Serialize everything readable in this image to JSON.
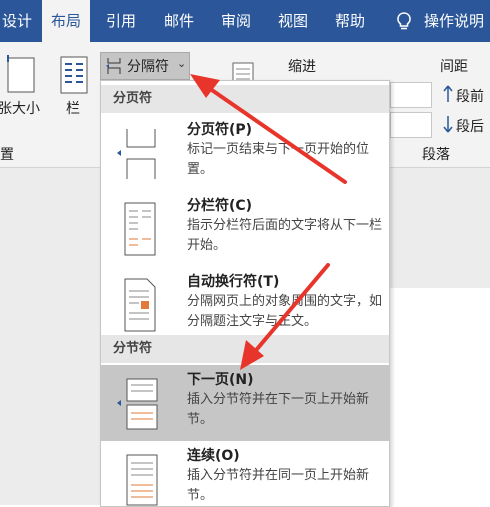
{
  "tabs": [
    {
      "label": "设计",
      "active": false
    },
    {
      "label": "布局",
      "active": true
    },
    {
      "label": "引用",
      "active": false
    },
    {
      "label": "邮件",
      "active": false
    },
    {
      "label": "审阅",
      "active": false
    },
    {
      "label": "视图",
      "active": false
    },
    {
      "label": "帮助",
      "active": false
    }
  ],
  "tell_me": "操作说明",
  "ribbon": {
    "paper_size": "张大小",
    "columns": "栏",
    "group_left": "置",
    "breaks_button": "分隔符",
    "indent_label": "缩进",
    "spacing_label": "间距",
    "spacing_before": "段前",
    "spacing_after": "段后",
    "paragraph_group": "段落"
  },
  "menu": {
    "page_breaks_header": "分页符",
    "section_breaks_header": "分节符",
    "items": [
      {
        "title": "分页符(P)",
        "desc": "标记一页结束与下一页开始的位置。"
      },
      {
        "title": "分栏符(C)",
        "desc": "指示分栏符后面的文字将从下一栏开始。"
      },
      {
        "title": "自动换行符(T)",
        "desc": "分隔网页上的对象周围的文字，如分隔题注文字与正文。"
      },
      {
        "title": "下一页(N)",
        "desc": "插入分节符并在下一页上开始新节。"
      },
      {
        "title": "连续(O)",
        "desc": "插入分节符并在同一页上开始新节。"
      }
    ]
  },
  "colors": {
    "tab_bar": "#2b579a",
    "arrow": "#e8352b",
    "highlight": "#c6c6c6"
  }
}
